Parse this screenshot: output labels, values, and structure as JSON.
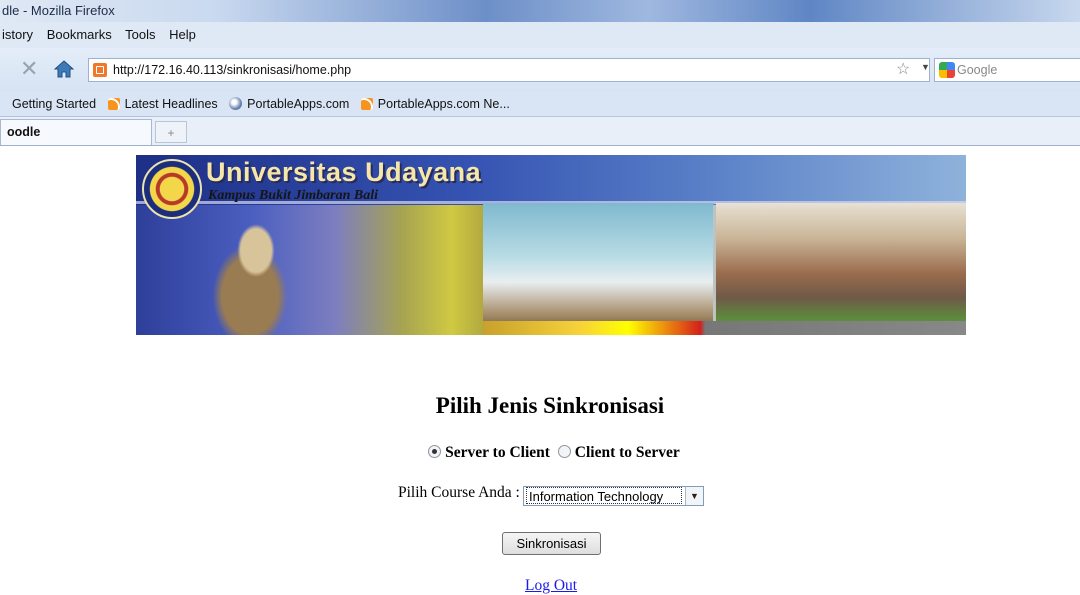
{
  "browser": {
    "window_title": "dle - Mozilla Firefox",
    "menu": [
      "istory",
      "Bookmarks",
      "Tools",
      "Help"
    ],
    "url": "http://172.16.40.113/sinkronisasi/home.php",
    "search_placeholder": "Google",
    "bookmarks": [
      "Getting Started",
      "Latest Headlines",
      "PortableApps.com",
      "PortableApps.com Ne..."
    ],
    "tab_title": "oodle",
    "new_tab": "+"
  },
  "banner": {
    "title": "Universitas Udayana",
    "subtitle": "Kampus Bukit Jimbaran Bali"
  },
  "main": {
    "heading": "Pilih Jenis Sinkronisasi",
    "radio_options": [
      {
        "label": "Server to Client",
        "selected": true
      },
      {
        "label": "Client to Server",
        "selected": false
      }
    ],
    "course_label": "Pilih Course Anda :",
    "course_selected": "Information Technology",
    "submit_label": "Sinkronisasi",
    "logout_label": "Log Out"
  }
}
